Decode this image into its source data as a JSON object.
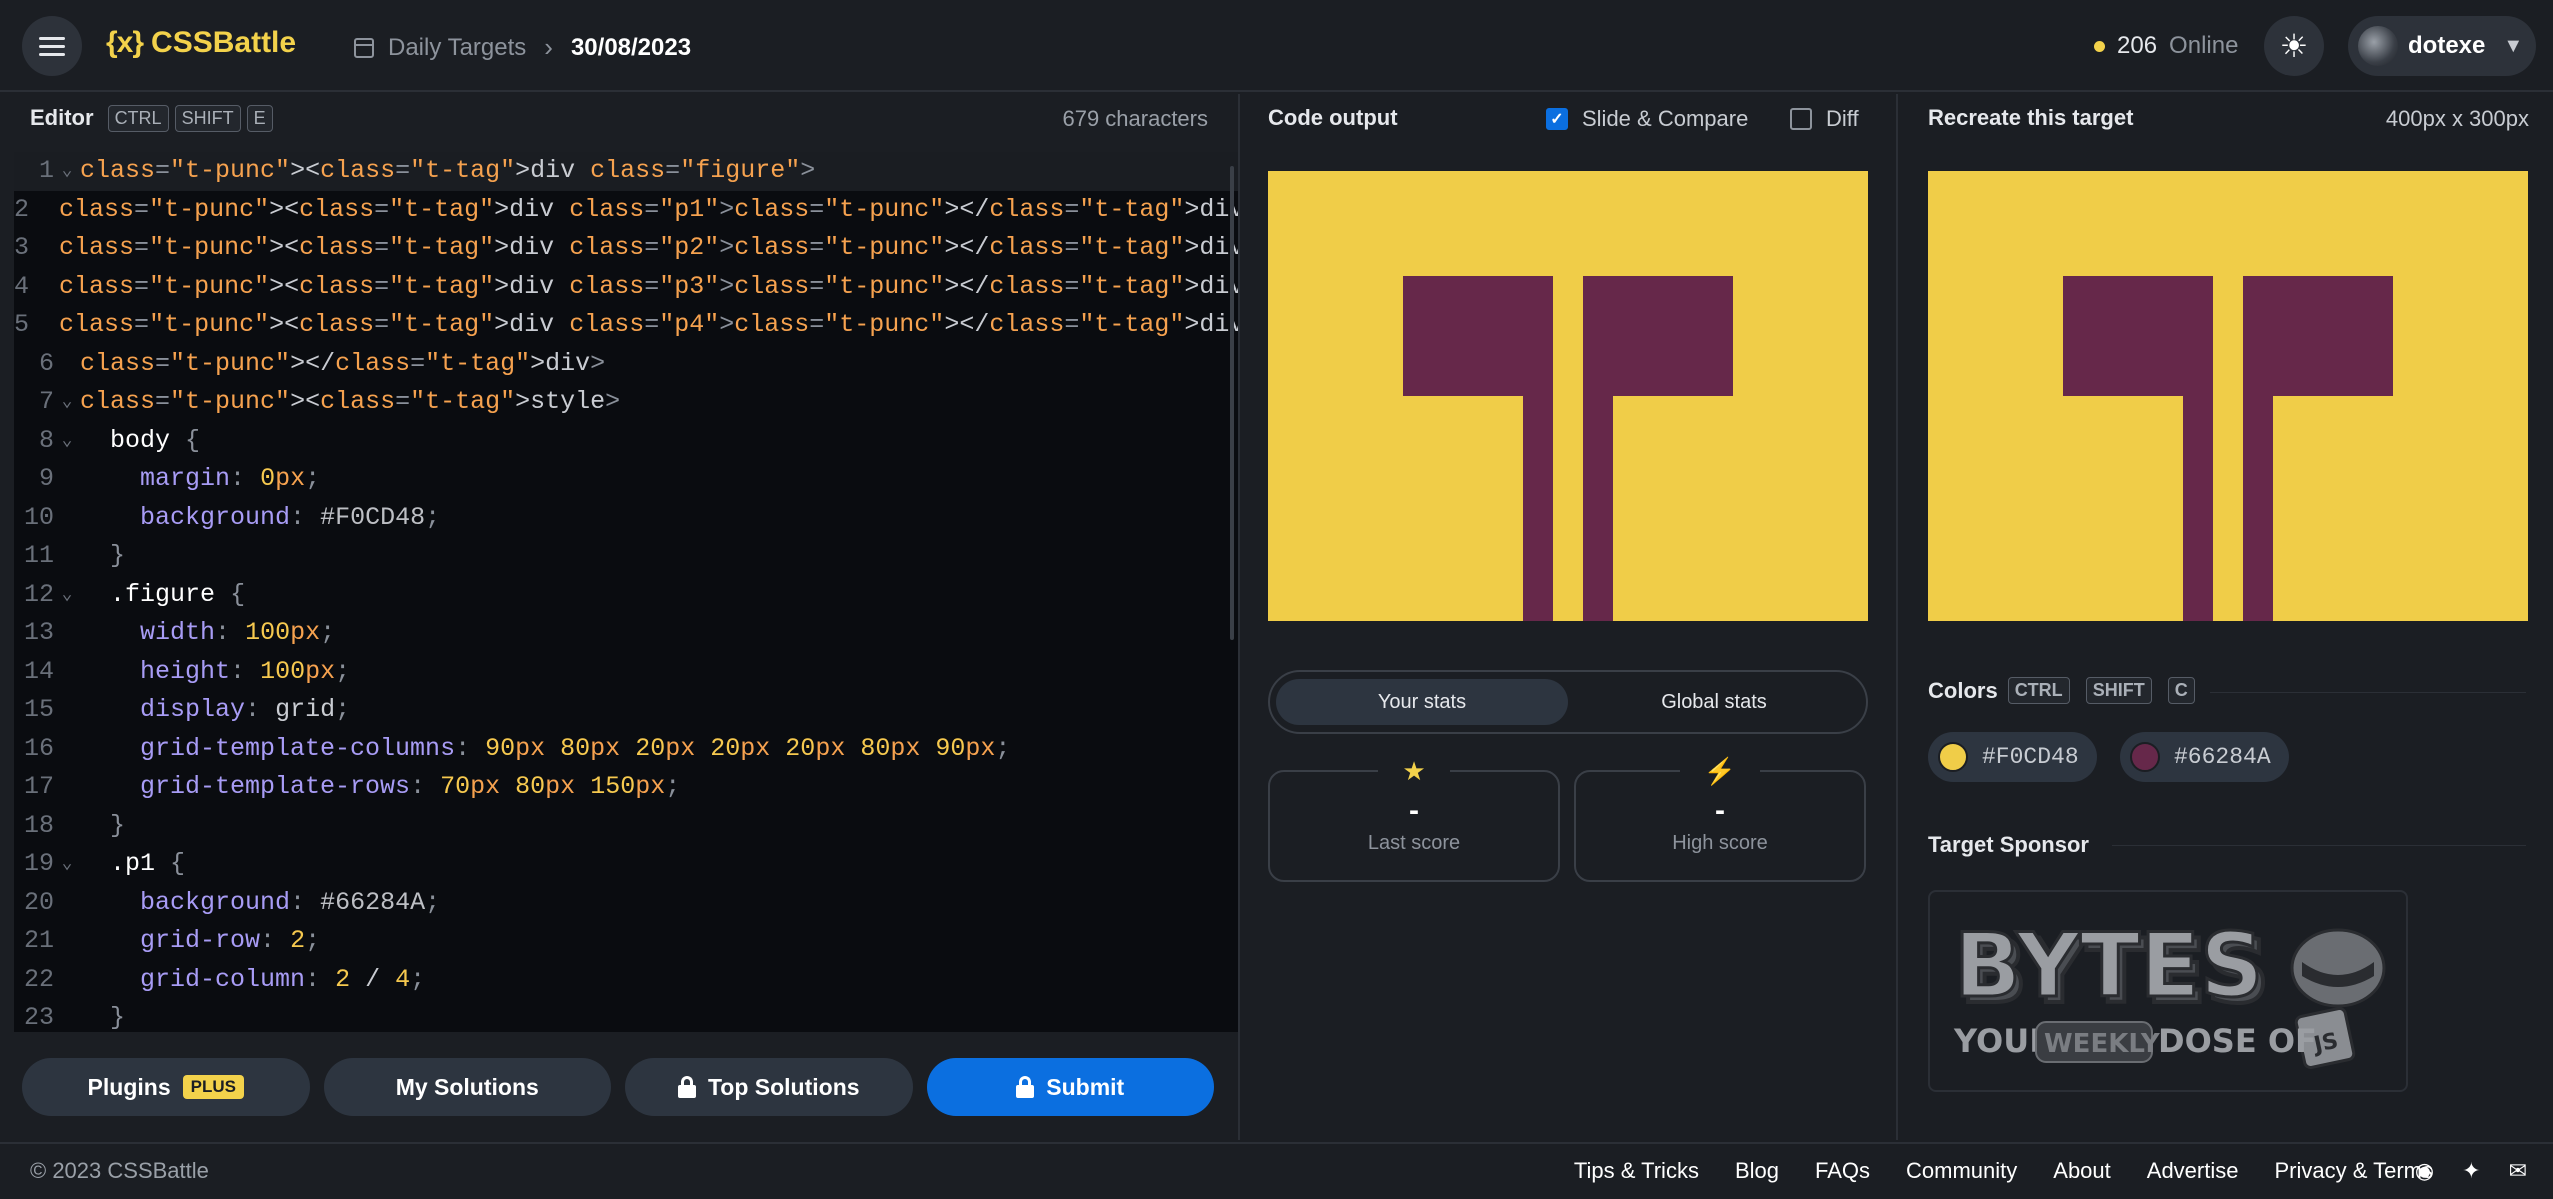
{
  "header": {
    "logo_text": "CSSBattle",
    "logo_mark": "{x}",
    "breadcrumb_section": "Daily Targets",
    "breadcrumb_date": "30/08/2023",
    "online_count": "206",
    "online_label": "Online",
    "username": "dotexe"
  },
  "editor": {
    "title": "Editor",
    "shortcut_keys": [
      "CTRL",
      "SHIFT",
      "E"
    ],
    "char_count": "679 characters",
    "lines": [
      "<div class=\"figure\">",
      "  <div class=\"p1\"></div>",
      "  <div class=\"p2\"></div>",
      "  <div class=\"p3\"></div>",
      "  <div class=\"p4\"></div>",
      "</div>",
      "<style>",
      "  body {",
      "    margin: 0px;",
      "    background: #F0CD48;",
      "  }",
      "  .figure {",
      "    width: 100px;",
      "    height: 100px;",
      "    display: grid;",
      "    grid-template-columns: 90px 80px 20px 20px 20px 80px 90px;",
      "    grid-template-rows: 70px 80px 150px;",
      "  }",
      "  .p1 {",
      "    background: #66284A;",
      "    grid-row: 2;",
      "    grid-column: 2 / 4;",
      "  }"
    ]
  },
  "buttons": {
    "plugins": "Plugins",
    "plugins_badge": "PLUS",
    "my_solutions": "My Solutions",
    "top_solutions": "Top Solutions",
    "submit": "Submit"
  },
  "output": {
    "title": "Code output",
    "slide_compare": "Slide & Compare",
    "diff": "Diff"
  },
  "stats": {
    "tab_your": "Your stats",
    "tab_global": "Global stats",
    "last_score_value": "-",
    "last_score_label": "Last score",
    "high_score_value": "-",
    "high_score_label": "High score"
  },
  "target": {
    "title": "Recreate this target",
    "size": "400px x 300px",
    "colors_label": "Colors",
    "colors_keys": [
      "CTRL",
      "SHIFT",
      "C"
    ],
    "colors": [
      "#F0CD48",
      "#66284A"
    ],
    "sponsor_label": "Target Sponsor",
    "sponsor_text_main": "BYTES",
    "sponsor_text_sub_1": "YOUR",
    "sponsor_text_sub_2": "WEEKLY",
    "sponsor_text_sub_3": "DOSE OF",
    "sponsor_badge": "JS"
  },
  "footer": {
    "copyright": "© 2023 CSSBattle",
    "links": [
      "Tips & Tricks",
      "Blog",
      "FAQs",
      "Community",
      "About",
      "Advertise",
      "Privacy & Terms"
    ]
  },
  "theme": {
    "accent": "#F3D24B",
    "primary_button": "#0B6FE0",
    "background": "#1B1E23",
    "target_bg": "#F0CD48",
    "target_shape": "#66284A"
  }
}
